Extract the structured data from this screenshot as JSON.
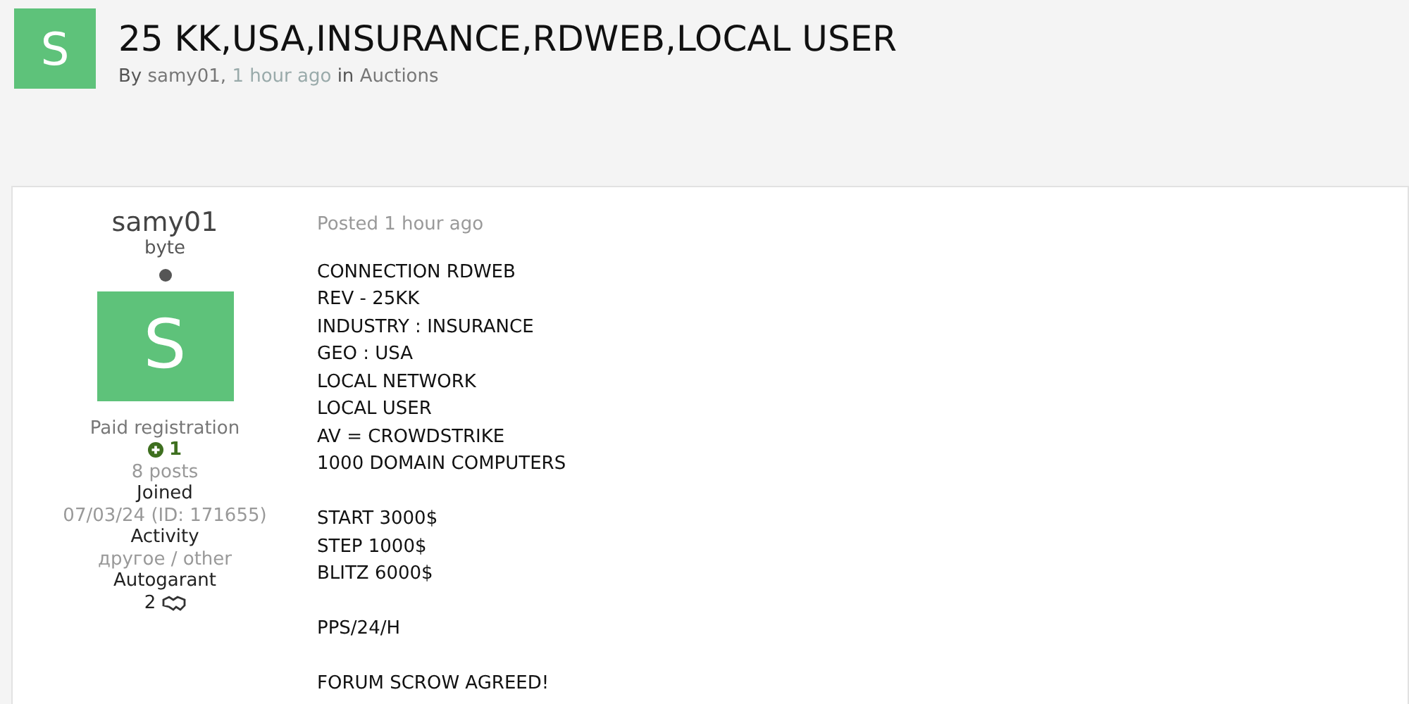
{
  "topic": {
    "avatar_letter": "S",
    "title": "25 KK,USA,INSURANCE,RDWEB,LOCAL USER",
    "by": "By",
    "author": "samy01,",
    "time": "1 hour ago",
    "in": "in",
    "forum": "Auctions"
  },
  "post": {
    "author": {
      "name": "samy01",
      "rank": "byte",
      "online": false,
      "avatar_letter": "S",
      "group": "Paid registration",
      "reputation": "1",
      "posts": "8 posts",
      "joined_label": "Joined",
      "joined": "07/03/24 (ID: 171655)",
      "activity_label": "Activity",
      "activity": "другое / other",
      "autogarant_label": "Autogarant",
      "autogarant": "2"
    },
    "posted": "Posted 1 hour ago",
    "paragraphs": [
      [
        "CONNECTION RDWEB",
        "REV - 25KK",
        "INDUSTRY : INSURANCE",
        "GEO : USA",
        "LOCAL NETWORK",
        "LOCAL USER",
        "AV = CROWDSTRIKE",
        "1000 DOMAIN COMPUTERS"
      ],
      [
        "START 3000$",
        "STEP 1000$",
        "BLITZ 6000$"
      ],
      [
        "PPS/24/H"
      ],
      [
        "FORUM SCROW AGREED!"
      ]
    ]
  }
}
